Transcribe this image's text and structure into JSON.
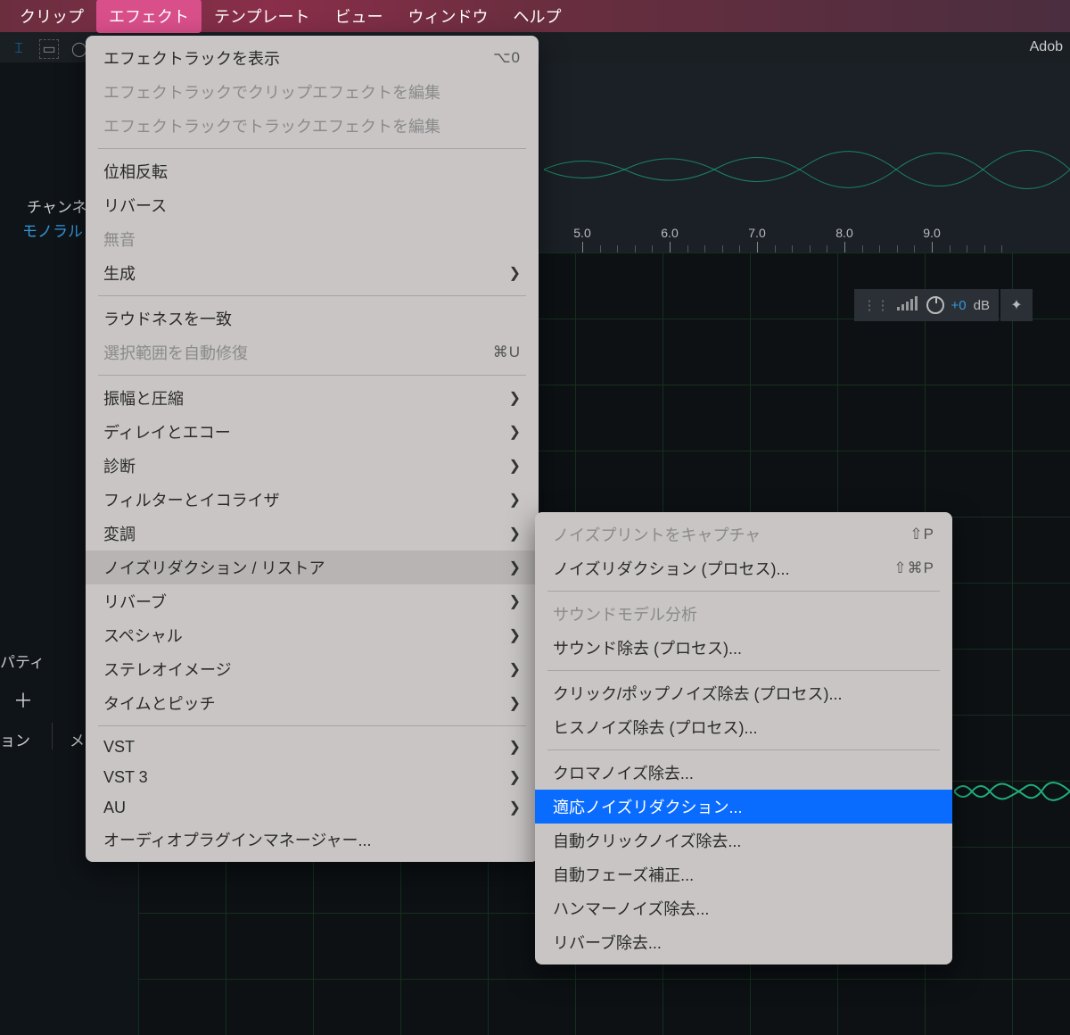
{
  "menubar": {
    "items": [
      "クリップ",
      "エフェクト",
      "テンプレート",
      "ビュー",
      "ウィンドウ",
      "ヘルプ"
    ],
    "active_index": 1
  },
  "topbar": {
    "app": "Adob"
  },
  "sidebar": {
    "channel_label": "チャンネ",
    "mono": "モノラル",
    "property": "パティ",
    "plus": "＋",
    "on": "ョン",
    "me": "メ"
  },
  "ruler": {
    "ticks": [
      "5.0",
      "6.0",
      "7.0",
      "8.0",
      "9.0"
    ]
  },
  "hud": {
    "db_label": "+0",
    "db_unit": "dB"
  },
  "effects_menu": {
    "groups": [
      [
        {
          "label": "エフェクトラックを表示",
          "shortcut": "⌥0",
          "sub": false,
          "disabled": false
        },
        {
          "label": "エフェクトラックでクリップエフェクトを編集",
          "sub": false,
          "disabled": true
        },
        {
          "label": "エフェクトラックでトラックエフェクトを編集",
          "sub": false,
          "disabled": true
        }
      ],
      [
        {
          "label": "位相反転",
          "sub": false,
          "disabled": false
        },
        {
          "label": "リバース",
          "sub": false,
          "disabled": false
        },
        {
          "label": "無音",
          "sub": false,
          "disabled": true
        },
        {
          "label": "生成",
          "sub": true,
          "disabled": false
        }
      ],
      [
        {
          "label": "ラウドネスを一致",
          "sub": false,
          "disabled": false
        },
        {
          "label": "選択範囲を自動修復",
          "shortcut": "⌘U",
          "sub": false,
          "disabled": true
        }
      ],
      [
        {
          "label": "振幅と圧縮",
          "sub": true,
          "disabled": false
        },
        {
          "label": "ディレイとエコー",
          "sub": true,
          "disabled": false
        },
        {
          "label": "診断",
          "sub": true,
          "disabled": false
        },
        {
          "label": "フィルターとイコライザ",
          "sub": true,
          "disabled": false
        },
        {
          "label": "変調",
          "sub": true,
          "disabled": false
        },
        {
          "label": "ノイズリダクション / リストア",
          "sub": true,
          "disabled": false,
          "hover": true
        },
        {
          "label": "リバーブ",
          "sub": true,
          "disabled": false
        },
        {
          "label": "スペシャル",
          "sub": true,
          "disabled": false
        },
        {
          "label": "ステレオイメージ",
          "sub": true,
          "disabled": false
        },
        {
          "label": "タイムとピッチ",
          "sub": true,
          "disabled": false
        }
      ],
      [
        {
          "label": "VST",
          "sub": true,
          "disabled": false
        },
        {
          "label": "VST 3",
          "sub": true,
          "disabled": false
        },
        {
          "label": "AU",
          "sub": true,
          "disabled": false
        },
        {
          "label": "オーディオプラグインマネージャー...",
          "sub": false,
          "disabled": false
        }
      ]
    ]
  },
  "noise_submenu": {
    "groups": [
      [
        {
          "label": "ノイズプリントをキャプチャ",
          "shortcut": "⇧P",
          "disabled": true
        },
        {
          "label": "ノイズリダクション (プロセス)...",
          "shortcut": "⇧⌘P",
          "disabled": false
        }
      ],
      [
        {
          "label": "サウンドモデル分析",
          "disabled": true
        },
        {
          "label": "サウンド除去 (プロセス)...",
          "disabled": false
        }
      ],
      [
        {
          "label": "クリック/ポップノイズ除去 (プロセス)...",
          "disabled": false
        },
        {
          "label": "ヒスノイズ除去 (プロセス)...",
          "disabled": false
        }
      ],
      [
        {
          "label": "クロマノイズ除去...",
          "disabled": false
        },
        {
          "label": "適応ノイズリダクション...",
          "disabled": false,
          "selected": true
        },
        {
          "label": "自動クリックノイズ除去...",
          "disabled": false
        },
        {
          "label": "自動フェーズ補正...",
          "disabled": false
        },
        {
          "label": "ハンマーノイズ除去...",
          "disabled": false
        },
        {
          "label": "リバーブ除去...",
          "disabled": false
        }
      ]
    ]
  }
}
